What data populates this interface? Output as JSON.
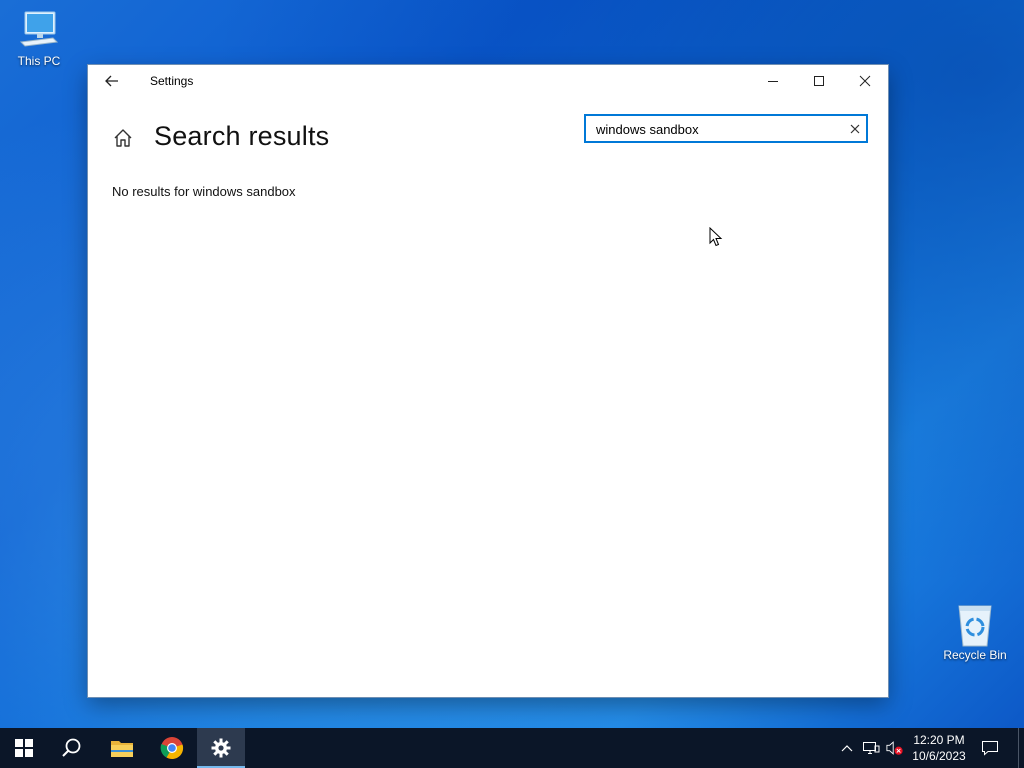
{
  "desktop": {
    "icons": [
      {
        "label": "This PC",
        "icon": "computer-icon"
      },
      {
        "label": "Recycle Bin",
        "icon": "recycle-bin-icon"
      }
    ]
  },
  "window": {
    "title": "Settings",
    "page_title": "Search results",
    "search": {
      "value": "windows sandbox",
      "placeholder": ""
    },
    "no_results_text": "No results for windows sandbox",
    "accent_color": "#0078d7"
  },
  "taskbar": {
    "pinned": [
      {
        "name": "Start",
        "icon": "windows-logo-icon"
      },
      {
        "name": "Search",
        "icon": "search-icon"
      },
      {
        "name": "File Explorer",
        "icon": "folder-icon"
      },
      {
        "name": "Google Chrome",
        "icon": "chrome-icon"
      },
      {
        "name": "Settings",
        "icon": "gear-icon",
        "active": true
      }
    ],
    "clock": {
      "time": "12:20 PM",
      "date": "10/6/2023"
    }
  }
}
